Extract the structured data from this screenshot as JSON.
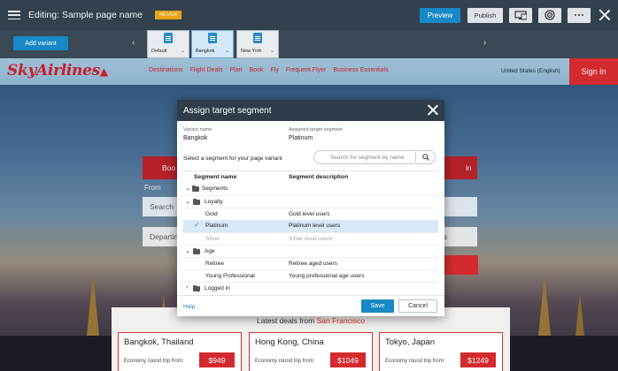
{
  "editor": {
    "title": "Editing: Sample page name",
    "badge": "NEVER",
    "preview_label": "Preview",
    "publish_label": "Publish",
    "tools": [
      "screen-icon",
      "target-icon",
      "more-icon"
    ]
  },
  "variants": {
    "add_label": "Add variant",
    "items": [
      {
        "label": "Default"
      },
      {
        "label": "Bangkok",
        "active": true
      },
      {
        "label": "New York"
      }
    ]
  },
  "site": {
    "logo": "SkyAirlines",
    "nav": [
      "Destinations",
      "Flight Deals",
      "Plan",
      "Book",
      "Fly",
      "Frequent Flyer",
      "Business Essentials"
    ],
    "locale": "United States (English)",
    "signin": "Sign In",
    "booking_tab_left": "Boo",
    "booking_tab_right": "in",
    "from_label": "From",
    "field_1": "Search",
    "field_2": "Departin",
    "field_3": "s"
  },
  "deals": {
    "title_prefix": "Latest deals from",
    "origin": "San Francisco",
    "cards": [
      {
        "city": "Bangkok, Thailand",
        "sub": "Economy round trip from:",
        "price": "$949"
      },
      {
        "city": "Hong Kong, China",
        "sub": "Economy round trip from:",
        "price": "$1049"
      },
      {
        "city": "Tokyo, Japan",
        "sub": "Economy round trip from:",
        "price": "$1249"
      }
    ]
  },
  "modal": {
    "title": "Assign target segment",
    "variant_name_label": "Variant name",
    "variant_name": "Bangkok",
    "assigned_label": "Assigned target segment",
    "assigned_value": "Platinum",
    "select_prompt": "Select a segment for your page variant",
    "search_placeholder": "Search for segment by name",
    "col_name": "Segment name",
    "col_desc": "Segment description",
    "rows": [
      {
        "name": "Segments",
        "desc": "",
        "level": 0,
        "folder": true,
        "chevron": "down"
      },
      {
        "name": "Loyalty",
        "desc": "",
        "level": 1,
        "folder": true,
        "chevron": "down"
      },
      {
        "name": "Gold",
        "desc": "Gold level users",
        "level": 2
      },
      {
        "name": "Platinum",
        "desc": "Platinum level users",
        "level": 2,
        "selected": true
      },
      {
        "name": "Silver",
        "desc": "Silver level users",
        "level": 2,
        "muted": true
      },
      {
        "name": "Age",
        "desc": "",
        "level": 1,
        "folder": true,
        "chevron": "down"
      },
      {
        "name": "Retiree",
        "desc": "Retiree aged users",
        "level": 2
      },
      {
        "name": "Young Professional",
        "desc": "Young professional age users",
        "level": 2
      },
      {
        "name": "Logged In",
        "desc": "",
        "level": 1,
        "folder": true,
        "chevron": "right"
      }
    ],
    "help": "Help",
    "save": "Save",
    "cancel": "Cancel"
  },
  "colors": {
    "accent": "#1689c6",
    "brand_red": "#d42a2f",
    "badge": "#e8a317",
    "selected_row": "#d7e8f6"
  }
}
